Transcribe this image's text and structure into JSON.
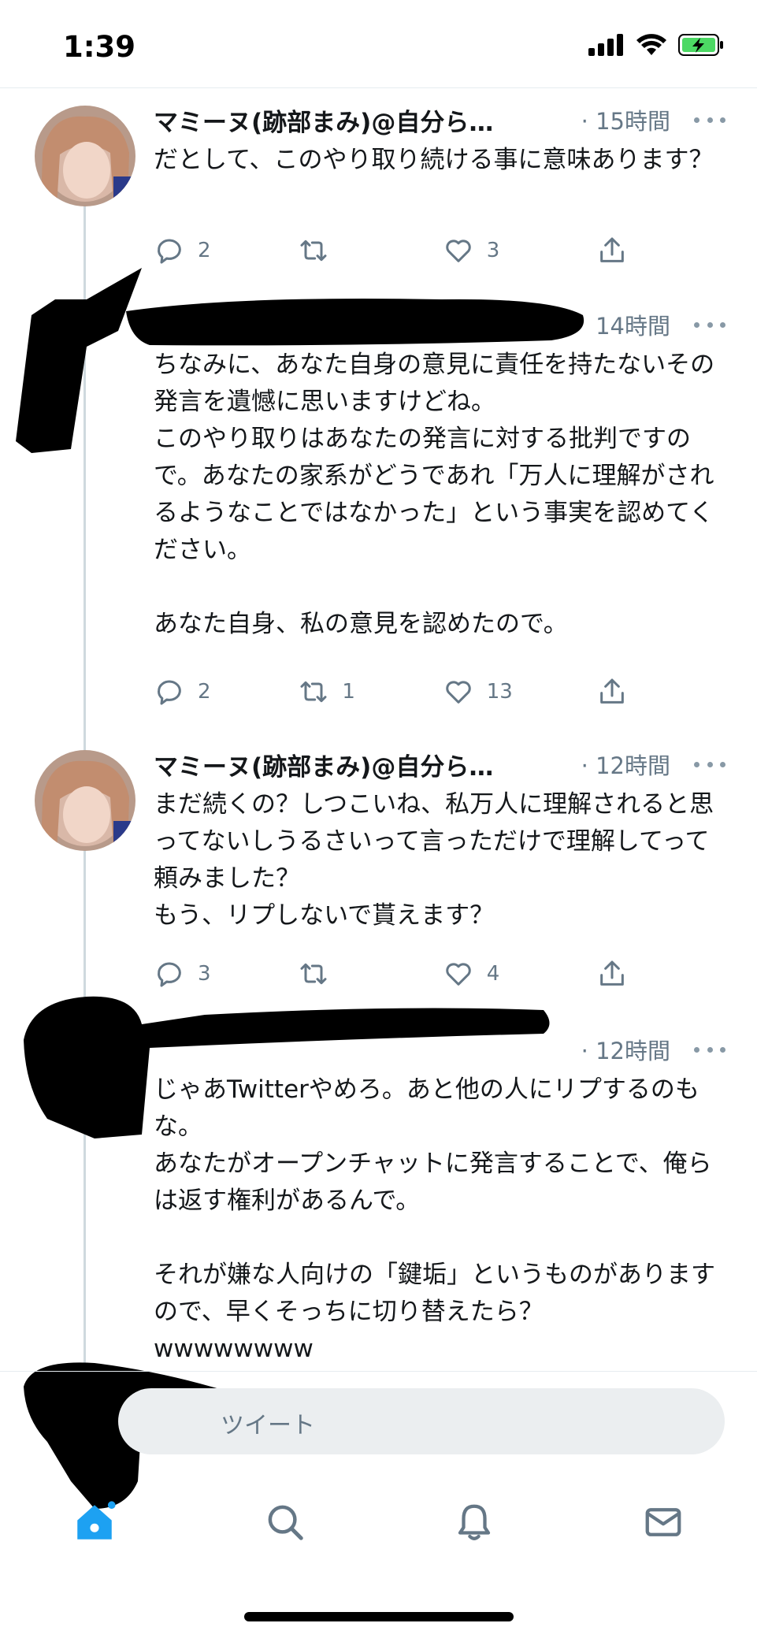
{
  "status_bar": {
    "time": "1:39"
  },
  "tweets": [
    {
      "author": "マミーヌ(跡部まみ)@自分ら…",
      "time": "· 15時間",
      "text": "だとして、このやり取り続ける事に意味あります？",
      "replies": "2",
      "retweets": "",
      "likes": "3"
    },
    {
      "author": "",
      "time": "14時間",
      "text": "ちなみに、あなた自身の意見に責任を持たないその発言を遺憾に思いますけどね。\nこのやり取りはあなたの発言に対する批判ですので。あなたの家系がどうであれ「万人に理解がされるようなことではなかった」という事実を認めてください。\n\nあなた自身、私の意見を認めたので。",
      "replies": "2",
      "retweets": "1",
      "likes": "13"
    },
    {
      "author": "マミーヌ(跡部まみ)@自分ら…",
      "time": "· 12時間",
      "text": "まだ続くの？しつこいね、私万人に理解されると思ってないしうるさいって言っただけで理解してって頼みました？\nもう、リプしないで貰えます？",
      "replies": "3",
      "retweets": "",
      "likes": "4"
    },
    {
      "author": "",
      "time": "· 12時間",
      "text": "じゃあTwitterやめろ。あと他の人にリプするのもな。\nあなたがオープンチャットに発言することで、俺らは返す権利があるんで。\n\nそれが嫌な人向けの「鍵垢」というものがありますので、早くそっちに切り替えたら？\nwwwwwwww",
      "replies": "",
      "retweets": "",
      "likes": ""
    }
  ],
  "compose": {
    "placeholder": "ツイート"
  },
  "colors": {
    "accent": "#1da1f2",
    "secondary_text": "#657786",
    "battery": "#4cd964"
  }
}
